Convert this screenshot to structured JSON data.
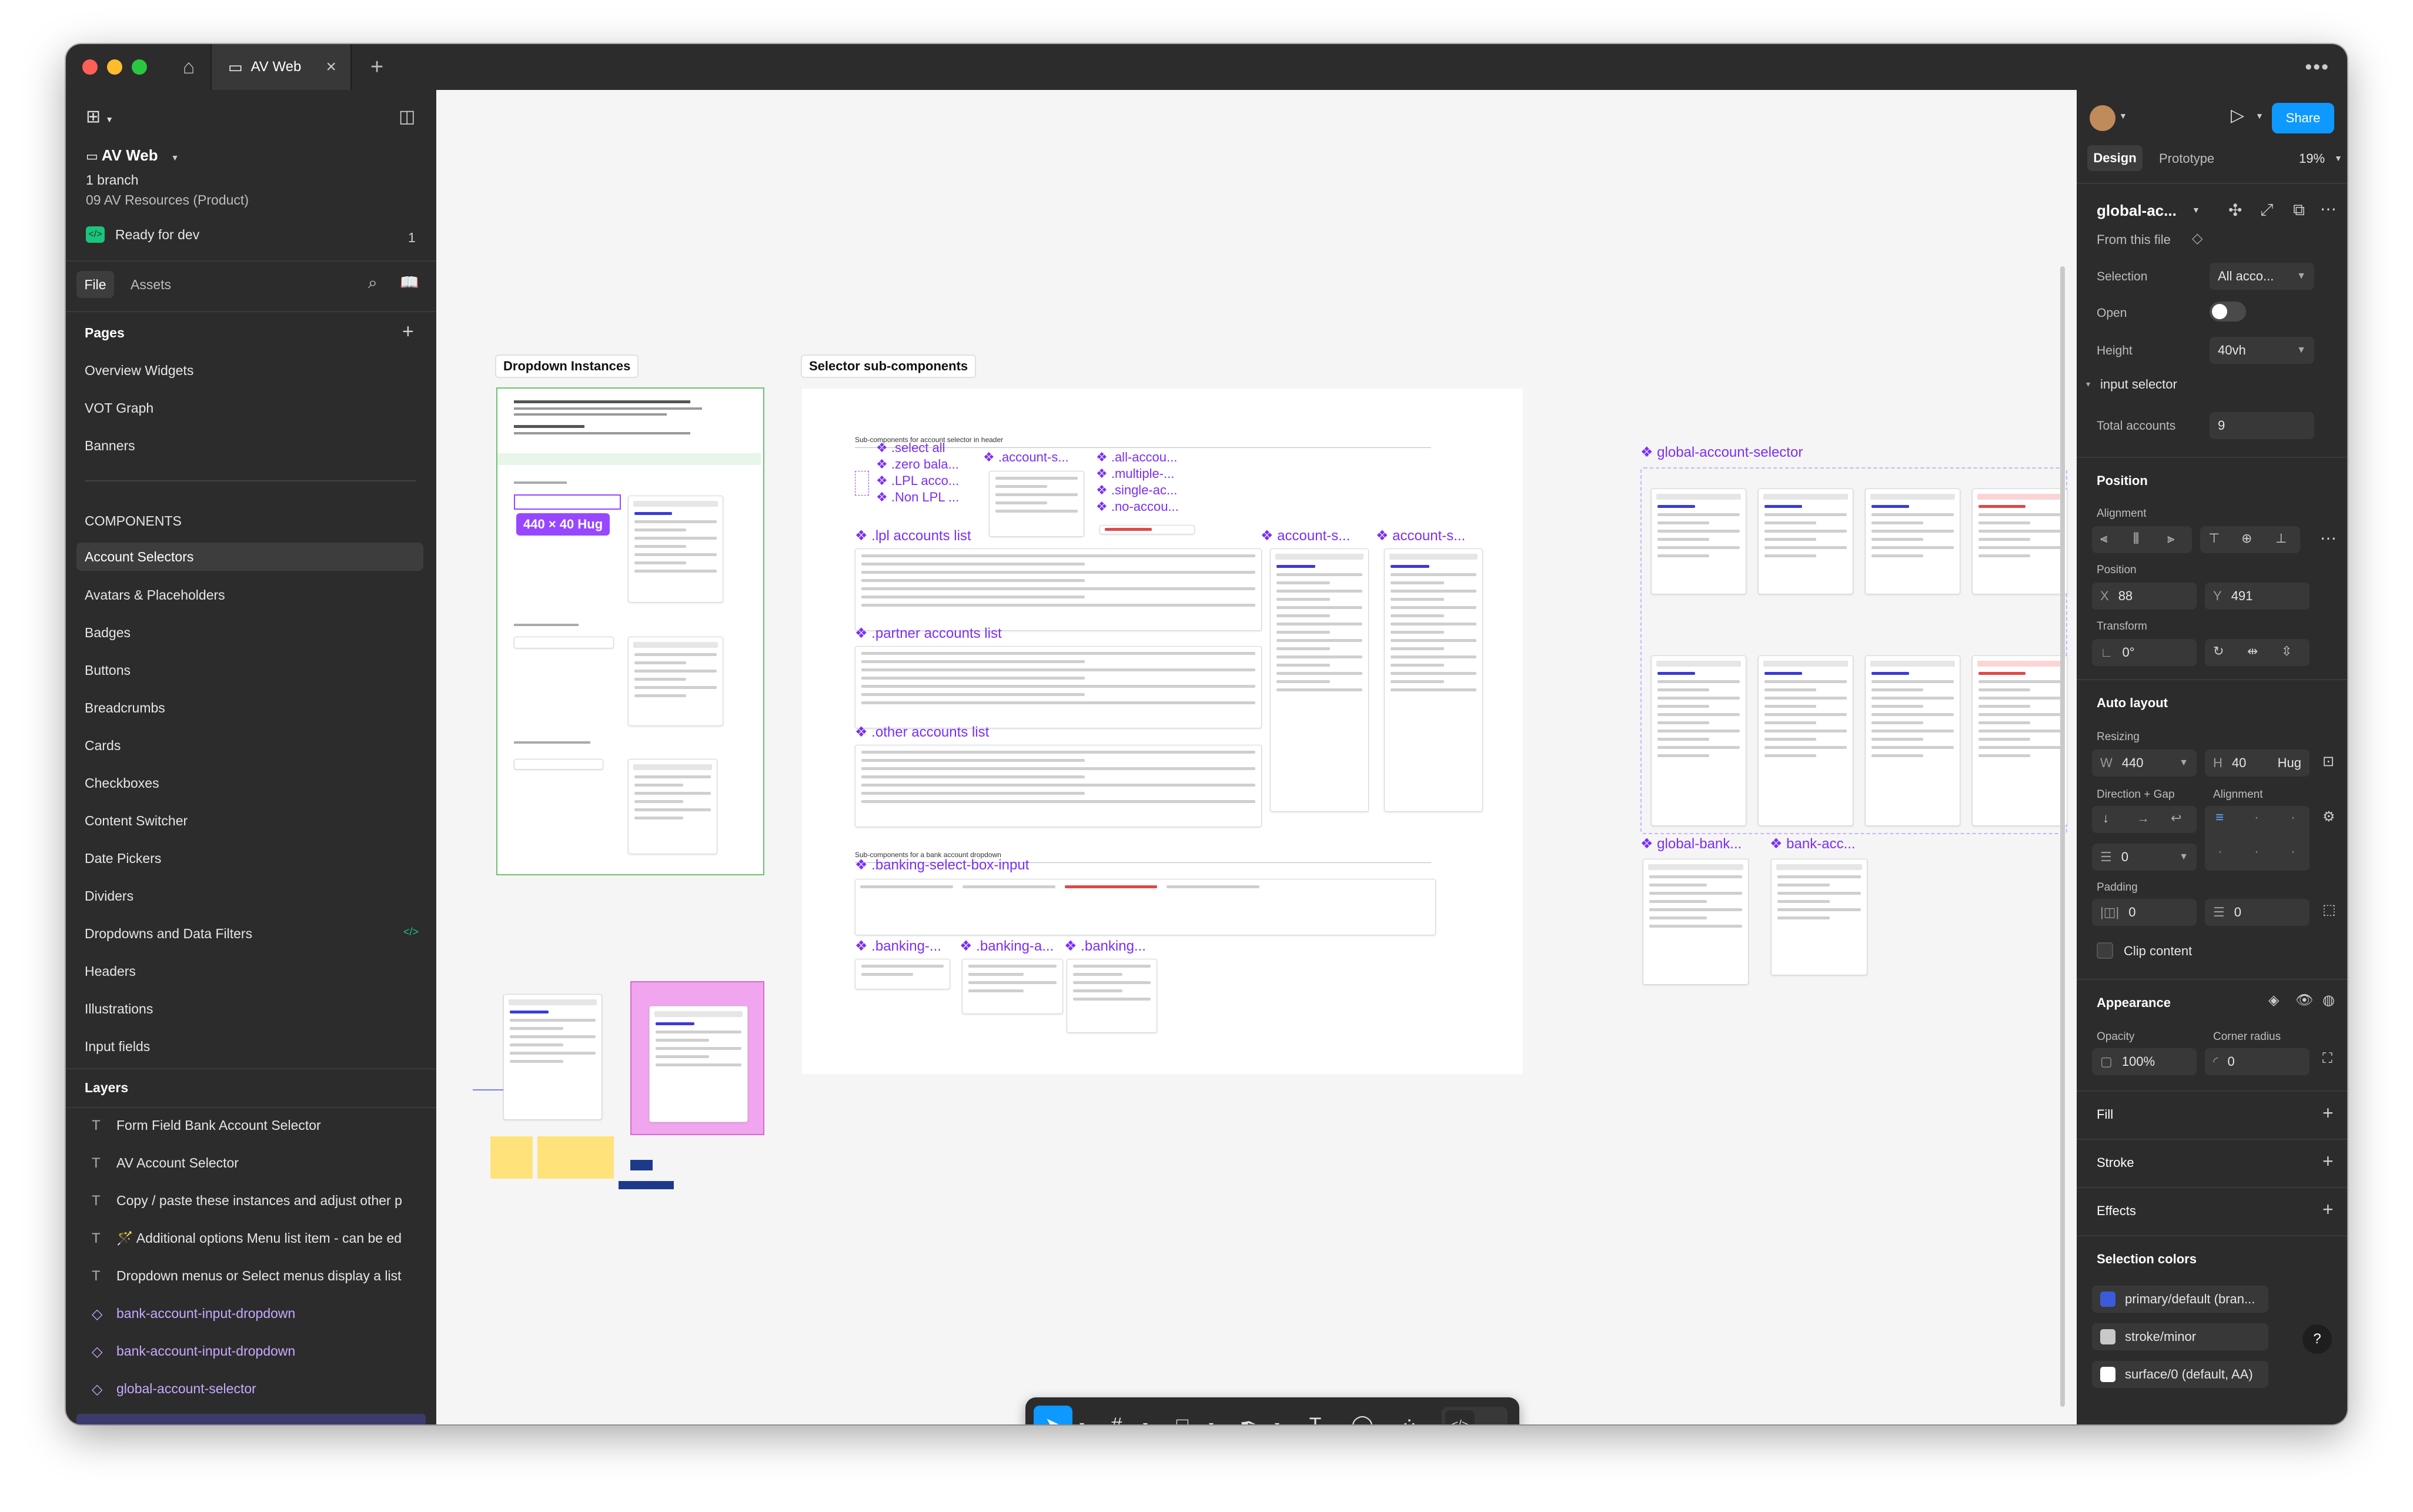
{
  "tab": {
    "title": "AV Web"
  },
  "file": {
    "name": "AV Web",
    "branch": "1 branch",
    "project": "09 AV Resources (Product)",
    "dev_status": "Ready for dev",
    "dev_count": "1",
    "tab_file": "File",
    "tab_assets": "Assets"
  },
  "pages": {
    "title": "Pages",
    "items": [
      "Overview Widgets",
      "VOT Graph",
      "Banners",
      "COMPONENTS",
      "Account Selectors",
      "Avatars & Placeholders",
      "Badges",
      "Buttons",
      "Breadcrumbs",
      "Cards",
      "Checkboxes",
      "Content Switcher",
      "Date Pickers",
      "Dividers",
      "Dropdowns and Data Filters",
      "Headers",
      "Illustrations",
      "Input fields"
    ]
  },
  "layers": {
    "title": "Layers",
    "items": [
      {
        "label": "Form Field Bank Account Selector",
        "icon": "T"
      },
      {
        "label": "AV Account Selector",
        "icon": "T"
      },
      {
        "label": "Copy / paste these instances and adjust other p",
        "icon": "T"
      },
      {
        "label": "🪄 Additional options Menu list item - can be ed",
        "icon": "T"
      },
      {
        "label": "Dropdown menus or Select menus display a list",
        "icon": "T"
      },
      {
        "label": "bank-account-input-dropdown",
        "icon": "◇"
      },
      {
        "label": "bank-account-input-dropdown",
        "icon": "◇"
      },
      {
        "label": "global-account-selector",
        "icon": "◇"
      }
    ]
  },
  "canvas": {
    "label_dropdown": "Dropdown Instances",
    "label_selector": "Selector sub-components",
    "size_pill": "440 × 40 Hug",
    "comp_global": "❖ global-account-selector",
    "comp_global_bank": "❖ global-bank...",
    "comp_bank_acc": "❖ bank-acc...",
    "sub_header": "Sub-components for account selector in header",
    "sub_bank": "Sub-components for a bank account dropdown",
    "comp_select_all": "❖ .select all",
    "comp_zero_bal": "❖ .zero bala...",
    "comp_lpl_acco": "❖ .LPL acco...",
    "comp_non_lpl": "❖ .Non LPL ...",
    "comp_account_s": "❖ .account-s...",
    "comp_all_accou": "❖ .all-accou...",
    "comp_multiple": "❖ .multiple-...",
    "comp_single_ac": "❖ .single-ac...",
    "comp_no_accou": "❖ .no-accou...",
    "comp_lpl_list": "❖ .lpl accounts list",
    "comp_account_s2": "❖ account-s...",
    "comp_account_s3": "❖ account-s...",
    "comp_partner": "❖ .partner accounts list",
    "comp_other": "❖ .other accounts list",
    "comp_banking_select": "❖ .banking-select-box-input",
    "comp_banking_1": "❖ .banking-...",
    "comp_banking_2": "❖ .banking-a...",
    "comp_banking_3": "❖ .banking..."
  },
  "right": {
    "share": "Share",
    "tab_design": "Design",
    "tab_prototype": "Prototype",
    "zoom": "19%",
    "component_name": "global-ac...",
    "from_file": "From this file",
    "selection_label": "Selection",
    "selection_value": "All acco...",
    "open_label": "Open",
    "height_label": "Height",
    "height_value": "40vh",
    "input_selector": "input selector",
    "total_label": "Total accounts",
    "total_value": "9",
    "position_title": "Position",
    "alignment_label": "Alignment",
    "position_label": "Position",
    "x_label": "X",
    "x_value": "88",
    "y_label": "Y",
    "y_value": "491",
    "transform_label": "Transform",
    "rotation": "0°",
    "autolayout_title": "Auto layout",
    "resizing_label": "Resizing",
    "w_label": "W",
    "w_value": "440",
    "h_label": "H",
    "h_value": "40",
    "h_mode": "Hug",
    "direction_label": "Direction + Gap",
    "alignment2_label": "Alignment",
    "gap_value": "0",
    "padding_label": "Padding",
    "pad_h": "0",
    "pad_v": "0",
    "clip": "Clip content",
    "appearance_title": "Appearance",
    "opacity_label": "Opacity",
    "opacity_value": "100%",
    "radius_label": "Corner radius",
    "radius_value": "0",
    "fill_title": "Fill",
    "stroke_title": "Stroke",
    "effects_title": "Effects",
    "selection_colors_title": "Selection colors",
    "colors": [
      {
        "name": "primary/default (bran...",
        "hex": "#3b5bdb"
      },
      {
        "name": "stroke/minor",
        "hex": "#c9c9c9"
      },
      {
        "name": "surface/0 (default, AA)",
        "hex": "#ffffff"
      }
    ],
    "help": "?"
  },
  "colors": {
    "accent": "#0d99ff",
    "component": "#9747ff",
    "panel": "#2c2c2c",
    "dev_green": "#1bc47d"
  }
}
